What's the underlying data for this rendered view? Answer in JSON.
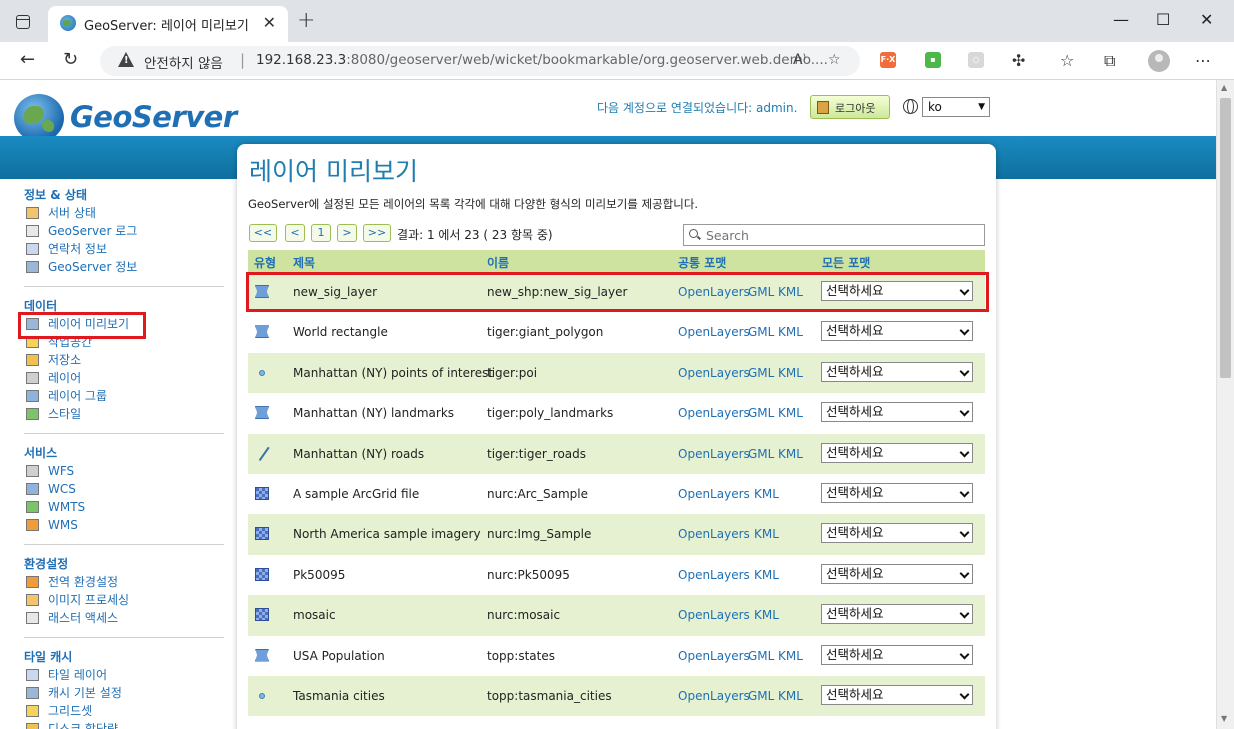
{
  "browser": {
    "tab_title": "GeoServer: 레이어 미리보기",
    "tab_close": "✕",
    "new_tab": "+",
    "url_warning": "안전하지 않음",
    "url_separator": "|",
    "url_host": "192.168.23.3",
    "url_rest": ":8080/geoserver/web/wicket/bookmarkable/org.geoserver.web.demo....",
    "extensions": [
      {
        "name": "fx-extension-icon",
        "label": "F·X",
        "color": "#f26b3a"
      },
      {
        "name": "green-extension-icon",
        "label": "▪",
        "color": "#4cb848"
      },
      {
        "name": "gray-extension-icon",
        "label": "○",
        "color": "#d8d8d8"
      }
    ],
    "window_controls": {
      "minimize": "—",
      "maximize": "☐",
      "close": "✕"
    }
  },
  "header": {
    "logo_text": "GeoServer",
    "login_text": "다음 계정으로 연결되었습니다: admin.",
    "logout_label": "로그아웃",
    "language": "ko"
  },
  "sidebar": {
    "sections": [
      {
        "title": "정보 & 상태",
        "items": [
          "서버 상태",
          "GeoServer 로그",
          "연락처 정보",
          "GeoServer 정보"
        ]
      },
      {
        "title": "데이터",
        "items": [
          "레이어 미리보기",
          "작업공간",
          "저장소",
          "레이어",
          "레이어 그룹",
          "스타일"
        ]
      },
      {
        "title": "서비스",
        "items": [
          "WFS",
          "WCS",
          "WMTS",
          "WMS"
        ]
      },
      {
        "title": "환경설정",
        "items": [
          "전역 환경설정",
          "이미지 프로세싱",
          "래스터 액세스"
        ]
      },
      {
        "title": "타일 캐시",
        "items": [
          "타일 레이어",
          "캐시 기본 설정",
          "그리드셋",
          "디스크 할당량"
        ]
      }
    ]
  },
  "panel": {
    "title": "레이어 미리보기",
    "description": "GeoServer에 설정된 모든 레이어의 목록 각각에 대해 다양한 형식의 미리보기를 제공합니다.",
    "pager": {
      "first": "<<",
      "prev": "<",
      "page": "1",
      "next": ">",
      "last": ">>"
    },
    "result_text": "결과: 1 에서 23 ( 23 항목 중)",
    "search_placeholder": "Search",
    "columns": {
      "type": "유형",
      "title": "제목",
      "name": "이름",
      "common": "공통 포맷",
      "all": "모든 포맷"
    },
    "select_label": "선택하세요",
    "rows": [
      {
        "type": "polygon",
        "title": "new_sig_layer",
        "name": "new_shp:new_sig_layer",
        "formats": [
          "OpenLayers",
          "GML",
          "KML"
        ]
      },
      {
        "type": "polygon",
        "title": "World rectangle",
        "name": "tiger:giant_polygon",
        "formats": [
          "OpenLayers",
          "GML",
          "KML"
        ]
      },
      {
        "type": "point",
        "title": "Manhattan (NY) points of interest",
        "name": "tiger:poi",
        "formats": [
          "OpenLayers",
          "GML",
          "KML"
        ]
      },
      {
        "type": "polygon",
        "title": "Manhattan (NY) landmarks",
        "name": "tiger:poly_landmarks",
        "formats": [
          "OpenLayers",
          "GML",
          "KML"
        ]
      },
      {
        "type": "line",
        "title": "Manhattan (NY) roads",
        "name": "tiger:tiger_roads",
        "formats": [
          "OpenLayers",
          "GML",
          "KML"
        ]
      },
      {
        "type": "raster",
        "title": "A sample ArcGrid file",
        "name": "nurc:Arc_Sample",
        "formats": [
          "OpenLayers",
          "",
          "KML"
        ]
      },
      {
        "type": "raster",
        "title": "North America sample imagery",
        "name": "nurc:Img_Sample",
        "formats": [
          "OpenLayers",
          "",
          "KML"
        ]
      },
      {
        "type": "raster",
        "title": "Pk50095",
        "name": "nurc:Pk50095",
        "formats": [
          "OpenLayers",
          "",
          "KML"
        ]
      },
      {
        "type": "raster",
        "title": "mosaic",
        "name": "nurc:mosaic",
        "formats": [
          "OpenLayers",
          "",
          "KML"
        ]
      },
      {
        "type": "polygon",
        "title": "USA Population",
        "name": "topp:states",
        "formats": [
          "OpenLayers",
          "GML",
          "KML"
        ]
      },
      {
        "type": "point",
        "title": "Tasmania cities",
        "name": "topp:tasmania_cities",
        "formats": [
          "OpenLayers",
          "GML",
          "KML"
        ]
      }
    ]
  }
}
